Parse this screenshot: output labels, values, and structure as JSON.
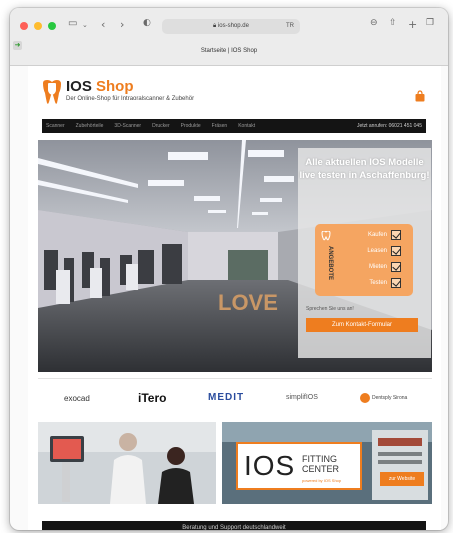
{
  "browser": {
    "url": "ios-shop.de",
    "tab_title": "Startseite | IOS Shop",
    "translate_label": "TR",
    "colors": {
      "close": "#fe5f57",
      "minimize": "#febc2e",
      "maximize": "#28c840"
    }
  },
  "site": {
    "brand_prefix": "IOS",
    "brand_suffix": "Shop",
    "tagline": "Der Online-Shop für Intraoralscanner & Zubehör",
    "accent_color": "#ee7d1f",
    "nav": {
      "items": [
        "Scanner",
        "Zubehörteile",
        "3D-Scanner",
        "Drucker",
        "Produkte",
        "Fräsen",
        "Kontakt"
      ],
      "phone": "Jetzt anrufen: 06021 451 045"
    },
    "hero": {
      "title": "Alle aktuellen IOS Modelle live testen in Aschaffenburg!",
      "side_label": "ANGEBOTE",
      "checklist": [
        "Kaufen",
        "Leasen",
        "Mieten",
        "Testen"
      ],
      "small_text": "Sprechen Sie uns an!",
      "button": "Zum Kontakt-Formular",
      "floor_sign": "LOVE"
    },
    "partners": [
      "exocad",
      "iTero",
      "MEDIT",
      "simplifIOS",
      "Dentsply Sirona"
    ],
    "cards": {
      "fitting_title": "IOS",
      "fitting_sub": "FITTING CENTER",
      "fitting_small": "powered by IOS Shop",
      "cta": "zur Website"
    },
    "footer": "Beratung und Support deutschlandweit"
  }
}
